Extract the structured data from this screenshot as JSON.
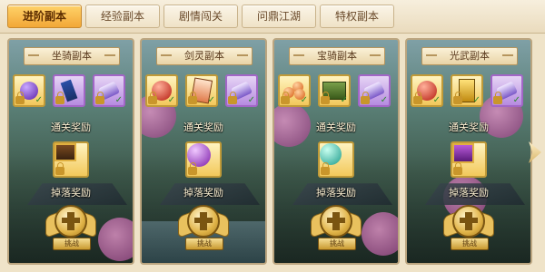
{
  "tabs": [
    {
      "label": "进阶副本",
      "active": true
    },
    {
      "label": "经验副本",
      "active": false
    },
    {
      "label": "剧情闯关",
      "active": false
    },
    {
      "label": "问鼎江湖",
      "active": false
    },
    {
      "label": "特权副本",
      "active": false
    }
  ],
  "panels": [
    {
      "title": "坐骑副本",
      "clear_reward_label": "通关奖励",
      "drop_reward_label": "掉落奖励",
      "challenge_label": "挑战"
    },
    {
      "title": "剑灵副本",
      "clear_reward_label": "通关奖励",
      "drop_reward_label": "掉落奖励",
      "challenge_label": "挑战"
    },
    {
      "title": "宝骑副本",
      "clear_reward_label": "通关奖励",
      "drop_reward_label": "掉落奖励",
      "challenge_label": "挑战"
    },
    {
      "title": "光武副本",
      "clear_reward_label": "通关奖励",
      "drop_reward_label": "掉落奖励",
      "challenge_label": "挑战"
    }
  ],
  "colors": {
    "tab_active": "#f2a737",
    "item_gold_border": "#c09a38",
    "item_purple_border": "#a266c7",
    "label_text": "#fff4d6"
  },
  "icons": {
    "next_arrow": "chevron-right-icon",
    "lock": "lock-icon",
    "check": "check-icon",
    "challenge": "challenge-badge-icon"
  }
}
